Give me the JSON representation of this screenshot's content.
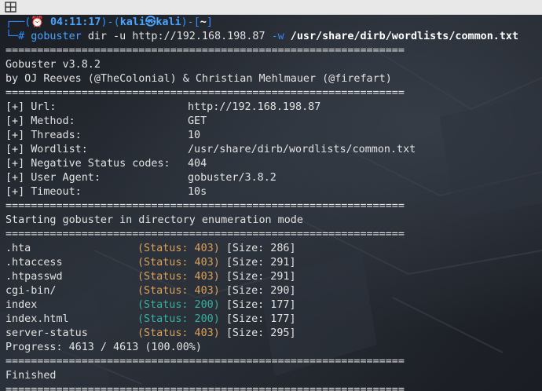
{
  "prompt": {
    "open": "┌──(",
    "clock_icon": "alarm-clock-icon",
    "time": "04:11:17",
    "mid": ")-(",
    "user": "kali",
    "at_symbol": "㉿",
    "host": "kali",
    "close": ")-[",
    "dir": "~",
    "end": "]",
    "line2_prefix": "└─#",
    "command": "gobuster",
    "args_part1": "dir -u http://192.168.198.87",
    "flag_w": "-w",
    "wordlist_path": "/usr/share/dirb/wordlists/common.txt"
  },
  "separator": "===============================================================",
  "header": {
    "version": "Gobuster v3.8.2",
    "authors": "by OJ Reeves (@TheColonial) & Christian Mehlmauer (@firefart)"
  },
  "config": [
    {
      "key": "[+] Url:",
      "value": "http://192.168.198.87"
    },
    {
      "key": "[+] Method:",
      "value": "GET"
    },
    {
      "key": "[+] Threads:",
      "value": "10"
    },
    {
      "key": "[+] Wordlist:",
      "value": "/usr/share/dirb/wordlists/common.txt"
    },
    {
      "key": "[+] Negative Status codes:",
      "value": "404"
    },
    {
      "key": "[+] User Agent:",
      "value": "gobuster/3.8.2"
    },
    {
      "key": "[+] Timeout:",
      "value": "10s"
    }
  ],
  "mode_text": "Starting gobuster in directory enumeration mode",
  "results": [
    {
      "path": ".hta",
      "status": "(Status: 403)",
      "size": "[Size: 286]",
      "code": "403"
    },
    {
      "path": ".htaccess",
      "status": "(Status: 403)",
      "size": "[Size: 291]",
      "code": "403"
    },
    {
      "path": ".htpasswd",
      "status": "(Status: 403)",
      "size": "[Size: 291]",
      "code": "403"
    },
    {
      "path": "cgi-bin/",
      "status": "(Status: 403)",
      "size": "[Size: 290]",
      "code": "403"
    },
    {
      "path": "index",
      "status": "(Status: 200)",
      "size": "[Size: 177]",
      "code": "200"
    },
    {
      "path": "index.html",
      "status": "(Status: 200)",
      "size": "[Size: 177]",
      "code": "200"
    },
    {
      "path": "server-status",
      "status": "(Status: 403)",
      "size": "[Size: 295]",
      "code": "403"
    }
  ],
  "progress": "Progress: 4613 / 4613 (100.00%)",
  "finished": "Finished",
  "topbar": {
    "icon": "window-layout-icon"
  },
  "colors": {
    "status_403": "#d9a05b",
    "status_200": "#36b0a0",
    "prompt_blue": "#2f8fff"
  }
}
